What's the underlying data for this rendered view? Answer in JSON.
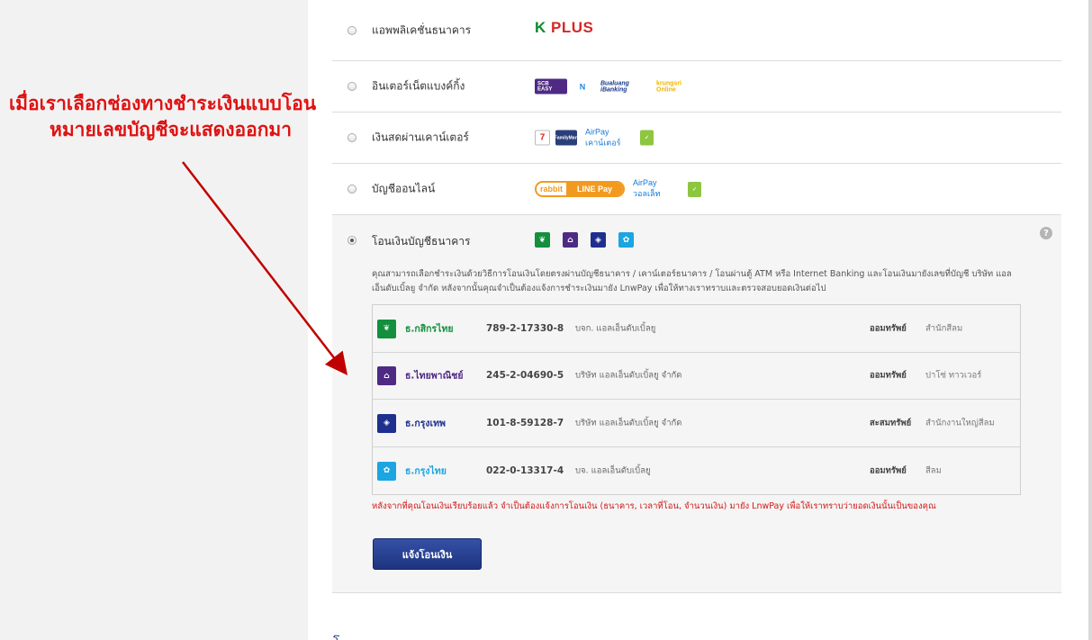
{
  "annotation": {
    "line1": "เมื่อเราเลือกช่องทางชำระเงินแบบโอน",
    "line2": "หมายเลขบัญชีจะแสดงออกมา",
    "color": "#e01010"
  },
  "payment_methods": [
    {
      "label": "แอพพลิเคชั่นธนาคาร",
      "selected": false,
      "logos": [
        "kplus-logo"
      ]
    },
    {
      "label": "อินเตอร์เน็ตแบงค์กิ้ง",
      "selected": false,
      "logos": [
        "scb-easy-logo",
        "ktb-netbank-logo",
        "bualuang-ibanking-logo",
        "krungsri-online-logo"
      ]
    },
    {
      "label": "เงินสดผ่านเคาน์เตอร์",
      "selected": false,
      "logos": [
        "seven-eleven-logo",
        "family-mart-logo",
        "airpay-counter-logo",
        "green-service-logo"
      ]
    },
    {
      "label": "บัญชีออนไลน์",
      "selected": false,
      "logos": [
        "rabbit-line-pay-logo",
        "airpay-wallet-logo",
        "green-wallet-logo"
      ]
    },
    {
      "label": "โอนเงินบัญชีธนาคาร",
      "selected": true,
      "logos": [
        "kbank-logo",
        "scb-logo",
        "bbl-logo",
        "ktb-logo"
      ]
    }
  ],
  "logo_text": {
    "kplus_k": "K",
    "kplus_rest": " PLUS",
    "scb_easy": "SCB EASY",
    "ktb_net": "N",
    "bualuang": "Bualuang iBanking",
    "krungsri": "krungsri Online",
    "seven": "7",
    "ft": "FamilyMart",
    "airpay_counter": "AirPay เคาน์เตอร์",
    "airpay_wallet": "AirPay วอลเล็ท",
    "rabbit": "rabbit",
    "line_pay": "LINE Pay"
  },
  "transfer": {
    "help_symbol": "?",
    "description": "คุณสามารถเลือกชำระเงินด้วยวิธีการโอนเงินโดยตรงผ่านบัญชีธนาคาร / เคาน์เตอร์ธนาคาร / โอนผ่านตู้ ATM หรือ Internet Banking และโอนเงินมายังเลขที่บัญชี บริษัท แอลเอ็นดับเบิ้ลยู จำกัด หลังจากนั้นคุณจำเป็นต้องแจ้งการชำระเงินมายัง LnwPay เพื่อให้ทางเราทราบและตรวจสอบยอดเงินต่อไป",
    "banks": [
      {
        "name": "ธ.กสิกรไทย",
        "name_color": "#138f3e",
        "account": "789-2-17330-8",
        "owner": "บจก. แอลเอ็นดับเบิ้ลยู",
        "type": "ออมทรัพย์",
        "branch": "สำนักสีลม",
        "logo": "kbank-logo"
      },
      {
        "name": "ธ.ไทยพาณิชย์",
        "name_color": "#4e2a84",
        "account": "245-2-04690-5",
        "owner": "บริษัท แอลเอ็นดับเบิ้ลยู จำกัด",
        "type": "ออมทรัพย์",
        "branch": "ปาโซ่ ทาวเวอร์",
        "logo": "scb-logo"
      },
      {
        "name": "ธ.กรุงเทพ",
        "name_color": "#1e2f8e",
        "account": "101-8-59128-7",
        "owner": "บริษัท แอลเอ็นดับเบิ้ลยู จำกัด",
        "type": "สะสมทรัพย์",
        "branch": "สำนักงานใหญ่สีลม",
        "logo": "bbl-logo"
      },
      {
        "name": "ธ.กรุงไทย",
        "name_color": "#1ba5e1",
        "account": "022-0-13317-4",
        "owner": "บจ. แอลเอ็นดับเบิ้ลยู",
        "type": "ออมทรัพย์",
        "branch": "สีลม",
        "logo": "ktb-logo"
      }
    ],
    "note": "หลังจากที่คุณโอนเงินเรียบร้อยแล้ว จำเป็นต้องแจ้งการโอนเงิน (ธนาคาร, เวลาที่โอน, จำนวนเงิน) มายัง LnwPay เพื่อให้เราทราบว่ายอดเงินนั้นเป็นของคุณ",
    "notify_button": "แจ้งโอนเงิน"
  },
  "bottom_partial_text": "โ...  ..."
}
